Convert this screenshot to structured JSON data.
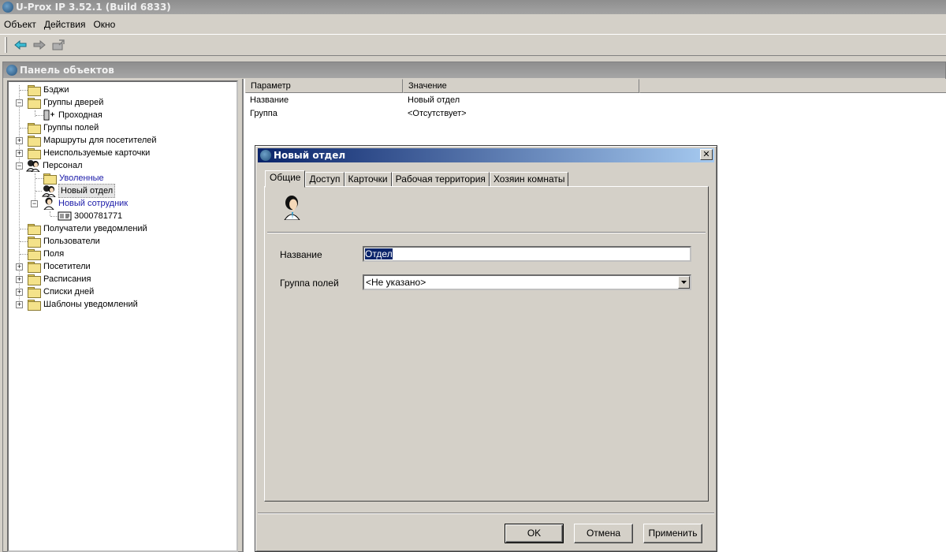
{
  "window": {
    "title": "U-Prox IP 3.52.1 (Build 6833)"
  },
  "menu": [
    "Объект",
    "Действия",
    "Окно"
  ],
  "panel": {
    "title": "Панель объектов"
  },
  "tree": [
    {
      "label": "Бэджи",
      "icon": "folder-icon"
    },
    {
      "label": "Группы дверей",
      "icon": "folder-icon"
    },
    {
      "label": "Проходная",
      "icon": "door-icon"
    },
    {
      "label": "Группы полей",
      "icon": "folder-icon"
    },
    {
      "label": "Маршруты для посетителей",
      "icon": "folder-icon"
    },
    {
      "label": "Неиспользуемые карточки",
      "icon": "folder-icon"
    },
    {
      "label": "Персонал",
      "icon": "people-icon"
    },
    {
      "label": "Уволенные",
      "icon": "folder-icon"
    },
    {
      "label": "Новый отдел",
      "icon": "people-icon"
    },
    {
      "label": "Новый сотрудник",
      "icon": "person-icon"
    },
    {
      "label": "3000781771",
      "icon": "card-icon"
    },
    {
      "label": "Получатели уведомлений",
      "icon": "folder-icon"
    },
    {
      "label": "Пользователи",
      "icon": "folder-icon"
    },
    {
      "label": "Поля",
      "icon": "folder-icon"
    },
    {
      "label": "Посетители",
      "icon": "folder-icon"
    },
    {
      "label": "Расписания",
      "icon": "folder-icon"
    },
    {
      "label": "Списки дней",
      "icon": "folder-icon"
    },
    {
      "label": "Шаблоны уведомлений",
      "icon": "folder-icon"
    }
  ],
  "grid": {
    "headers": [
      "Параметр",
      "Значение"
    ],
    "rows": [
      [
        "Название",
        "Новый отдел"
      ],
      [
        "Группа",
        "<Отсутствует>"
      ]
    ]
  },
  "dialog": {
    "title": "Новый отдел",
    "tabs": [
      "Общие",
      "Доступ",
      "Карточки",
      "Рабочая территория",
      "Хозяин комнаты"
    ],
    "name_label": "Название",
    "name_value": "Отдел",
    "group_label": "Группа полей",
    "group_value": "<Не указано>",
    "ok": "OK",
    "cancel": "Отмена",
    "apply": "Применить"
  }
}
